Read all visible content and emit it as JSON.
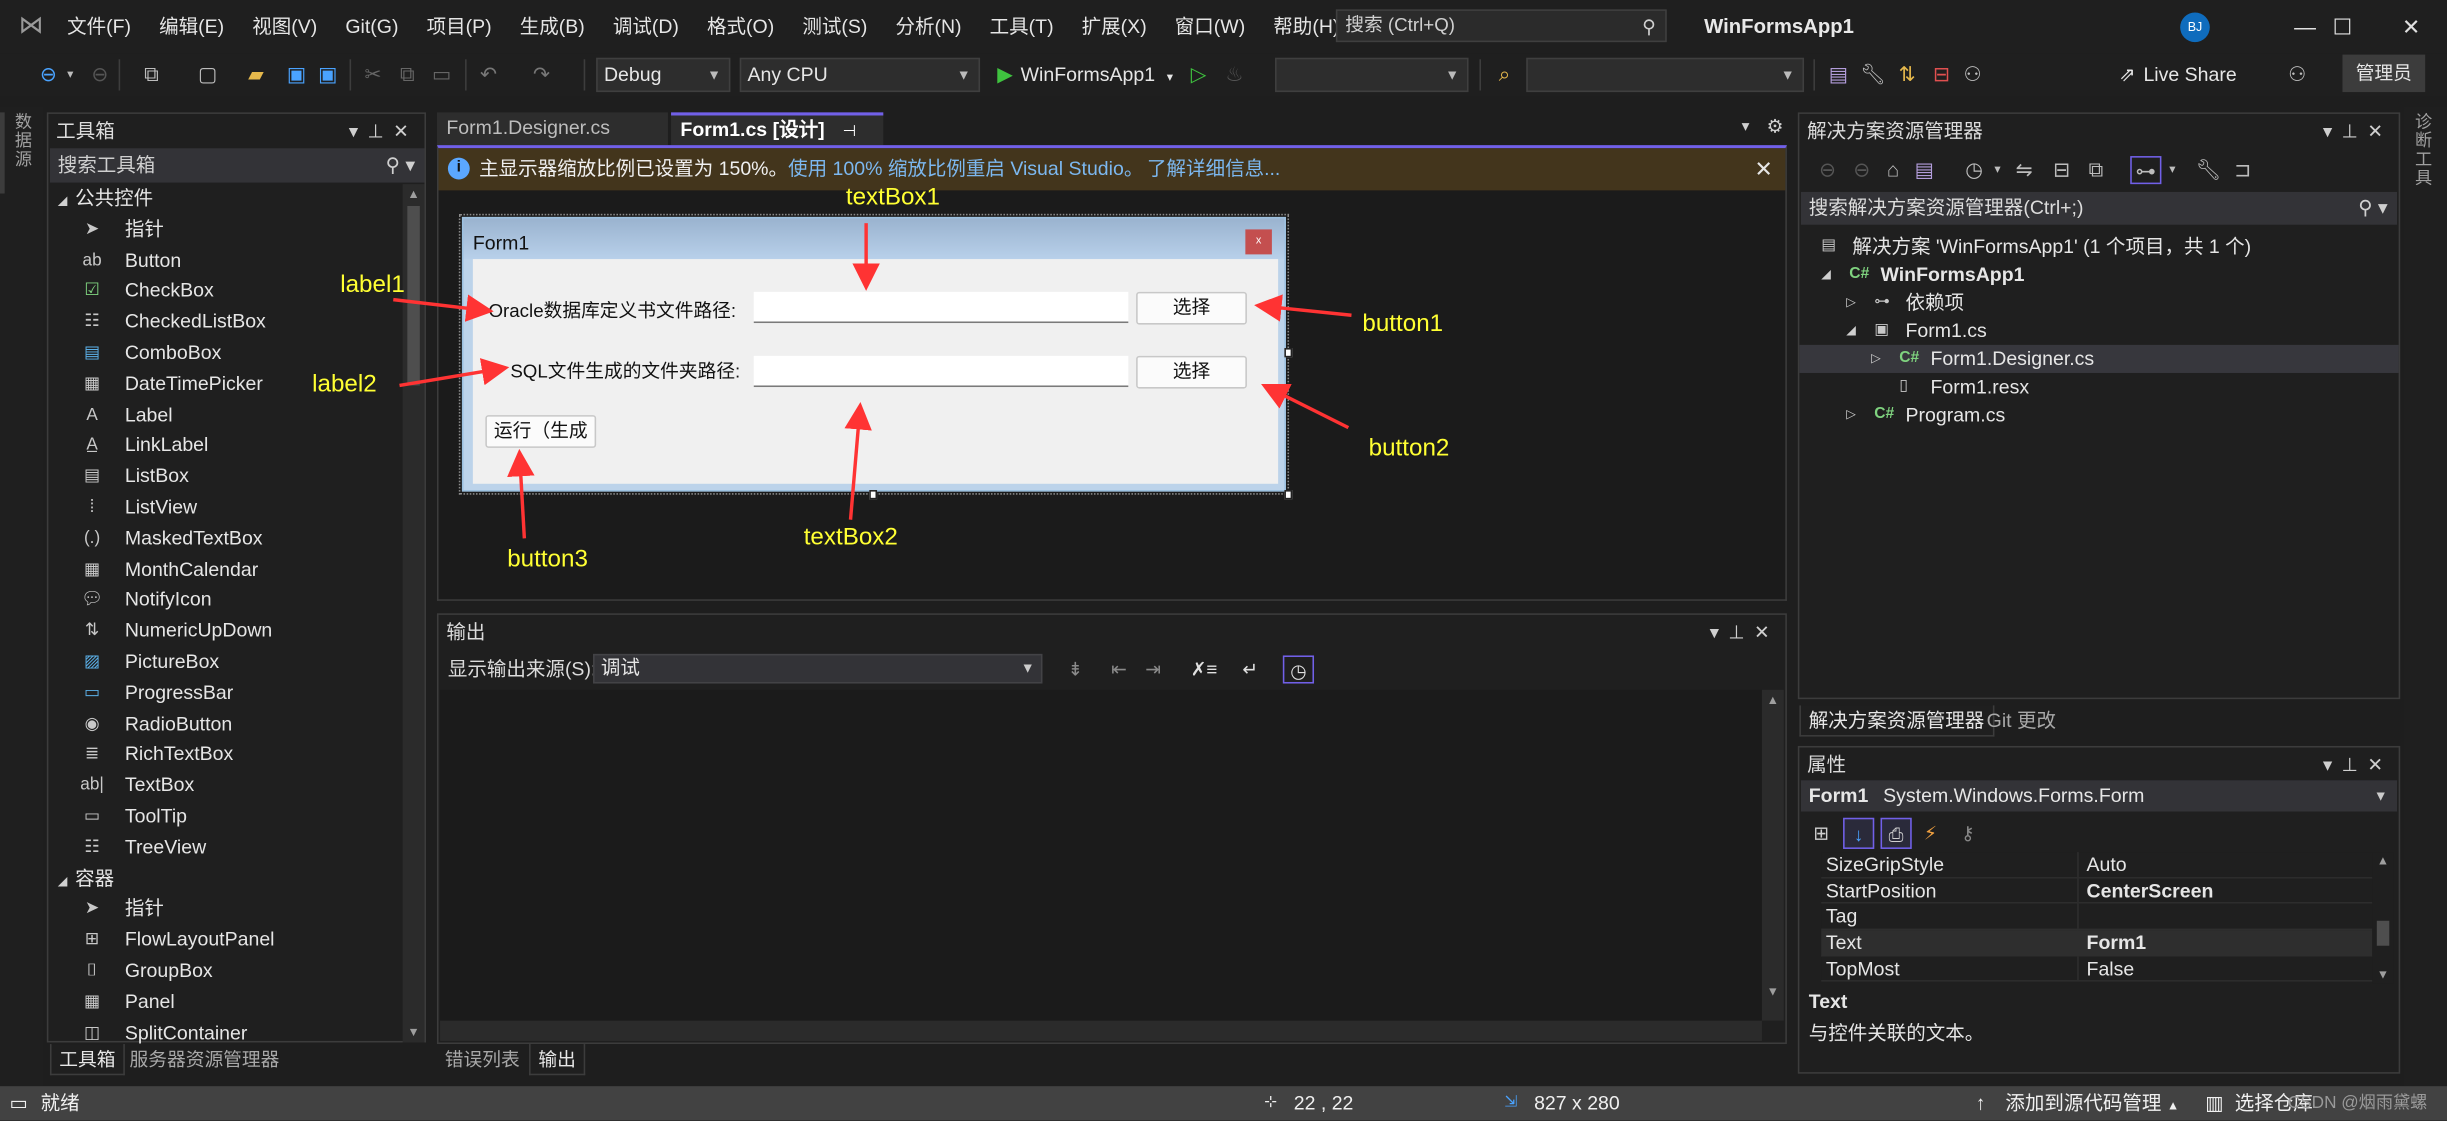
{
  "window": {
    "app_title": "WinFormsApp1",
    "avatar_initials": "BJ",
    "search_placeholder": "搜索 (Ctrl+Q)",
    "minimize_glyph": "—",
    "maximize_glyph": "☐",
    "close_glyph": "✕"
  },
  "menu": [
    "文件(F)",
    "编辑(E)",
    "视图(V)",
    "Git(G)",
    "项目(P)",
    "生成(B)",
    "调试(D)",
    "格式(O)",
    "测试(S)",
    "分析(N)",
    "工具(T)",
    "扩展(X)",
    "窗口(W)",
    "帮助(H)"
  ],
  "toolbar": {
    "configuration": "Debug",
    "platform": "Any CPU",
    "start_target": "WinFormsApp1",
    "live_share": "Live Share",
    "admin": "管理员"
  },
  "left_strip": {
    "data_sources_tab": "数据源"
  },
  "right_strip": {
    "diagnostics_tab": "诊断工具"
  },
  "toolbox": {
    "title": "工具箱",
    "search_placeholder": "搜索工具箱",
    "groups": [
      {
        "name": "公共控件",
        "items": [
          {
            "label": "指针",
            "icon": "pointer-icon"
          },
          {
            "label": "Button",
            "icon": "button-icon"
          },
          {
            "label": "CheckBox",
            "icon": "checkbox-icon"
          },
          {
            "label": "CheckedListBox",
            "icon": "checkedlistbox-icon"
          },
          {
            "label": "ComboBox",
            "icon": "combobox-icon"
          },
          {
            "label": "DateTimePicker",
            "icon": "datetimepicker-icon"
          },
          {
            "label": "Label",
            "icon": "label-icon"
          },
          {
            "label": "LinkLabel",
            "icon": "linklabel-icon"
          },
          {
            "label": "ListBox",
            "icon": "listbox-icon"
          },
          {
            "label": "ListView",
            "icon": "listview-icon"
          },
          {
            "label": "MaskedTextBox",
            "icon": "maskedtextbox-icon"
          },
          {
            "label": "MonthCalendar",
            "icon": "monthcalendar-icon"
          },
          {
            "label": "NotifyIcon",
            "icon": "notifyicon-icon"
          },
          {
            "label": "NumericUpDown",
            "icon": "numericupdown-icon"
          },
          {
            "label": "PictureBox",
            "icon": "picturebox-icon"
          },
          {
            "label": "ProgressBar",
            "icon": "progressbar-icon"
          },
          {
            "label": "RadioButton",
            "icon": "radiobutton-icon"
          },
          {
            "label": "RichTextBox",
            "icon": "richtextbox-icon"
          },
          {
            "label": "TextBox",
            "icon": "textbox-icon"
          },
          {
            "label": "ToolTip",
            "icon": "tooltip-icon"
          },
          {
            "label": "TreeView",
            "icon": "treeview-icon"
          }
        ]
      },
      {
        "name": "容器",
        "items": [
          {
            "label": "指针",
            "icon": "pointer-icon"
          },
          {
            "label": "FlowLayoutPanel",
            "icon": "flowlayoutpanel-icon"
          },
          {
            "label": "GroupBox",
            "icon": "groupbox-icon"
          },
          {
            "label": "Panel",
            "icon": "panel-icon"
          },
          {
            "label": "SplitContainer",
            "icon": "splitcontainer-icon"
          }
        ]
      }
    ],
    "bottom_tabs": [
      "工具箱",
      "服务器资源管理器"
    ]
  },
  "editor": {
    "tabs": [
      {
        "label": "Form1.Designer.cs",
        "active": false
      },
      {
        "label": "Form1.cs [设计]",
        "active": true
      }
    ],
    "infobar": {
      "message": "主显示器缩放比例已设置为 150%。",
      "action_link": "使用 100% 缩放比例重启 Visual Studio。",
      "learn_more_link": "了解详细信息..."
    }
  },
  "designer_form": {
    "title": "Form1",
    "close_glyph": "x",
    "label1": "Oracle数据库定义书文件路径:",
    "label2": "SQL文件生成的文件夹路径:",
    "textbox1_value": "",
    "textbox2_value": "",
    "button1": "选择",
    "button2": "选择",
    "button3": "运行（生成"
  },
  "annotations": {
    "label1": "label1",
    "label2": "label2",
    "textBox1": "textBox1",
    "textBox2": "textBox2",
    "button1": "button1",
    "button2": "button2",
    "button3": "button3",
    "arrow_color": "#ff3333",
    "text_color": "#ffff33"
  },
  "output": {
    "title": "输出",
    "source_label": "显示输出来源(S):",
    "source_value": "调试",
    "bottom_tabs": [
      "错误列表",
      "输出"
    ]
  },
  "solution_explorer": {
    "title": "解决方案资源管理器",
    "search_placeholder": "搜索解决方案资源管理器(Ctrl+;)",
    "tree": [
      {
        "label": "解决方案 'WinFormsApp1' (1 个项目，共 1 个)",
        "level": 0,
        "expander": "",
        "icon": "solution-icon"
      },
      {
        "label": "WinFormsApp1",
        "level": 1,
        "expander": "expanded",
        "icon": "csharp-project-icon",
        "bold": true
      },
      {
        "label": "依赖项",
        "level": 2,
        "expander": "collapsed",
        "icon": "dependencies-icon"
      },
      {
        "label": "Form1.cs",
        "level": 2,
        "expander": "expanded",
        "icon": "form-icon"
      },
      {
        "label": "Form1.Designer.cs",
        "level": 3,
        "expander": "collapsed",
        "icon": "csharp-file-icon",
        "selected": true
      },
      {
        "label": "Form1.resx",
        "level": 3,
        "expander": "",
        "icon": "resx-file-icon"
      },
      {
        "label": "Program.cs",
        "level": 2,
        "expander": "collapsed",
        "icon": "csharp-file-icon"
      }
    ],
    "bottom_tabs": [
      "解决方案资源管理器",
      "Git 更改"
    ]
  },
  "properties": {
    "title": "属性",
    "object_name": "Form1",
    "object_type": "System.Windows.Forms.Form",
    "rows": [
      {
        "name": "SizeGripStyle",
        "value": "Auto",
        "bold": false
      },
      {
        "name": "StartPosition",
        "value": "CenterScreen",
        "bold": true
      },
      {
        "name": "Tag",
        "value": "",
        "bold": false
      },
      {
        "name": "Text",
        "value": "Form1",
        "bold": true,
        "selected": true
      },
      {
        "name": "TopMost",
        "value": "False",
        "bold": false
      }
    ],
    "description_title": "Text",
    "description_text": "与控件关联的文本。"
  },
  "statusbar": {
    "ready": "就绪",
    "position": "22 , 22",
    "size": "827 x 280",
    "add_to_source_control": "添加到源代码管理",
    "select_repo": "选择仓库",
    "watermark": "CSDN @烟雨黛螺"
  },
  "colors": {
    "accent": "#7160e8",
    "infobar_bg": "#43351c",
    "link": "#7cb8f0",
    "csharp": "#7fd37f"
  }
}
